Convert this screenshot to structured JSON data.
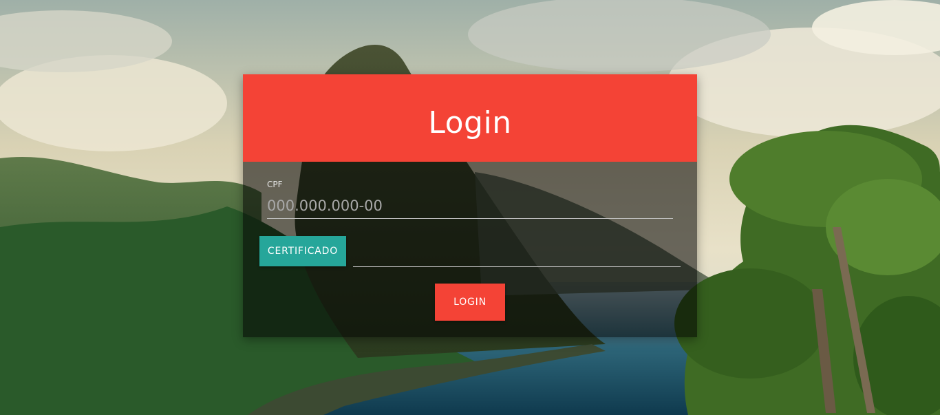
{
  "login": {
    "title": "Login",
    "cpf_label": "CPF",
    "cpf_placeholder": "000.000.000-00",
    "cpf_value": "",
    "certificate_button": "CERTIFICADO",
    "certificate_file_value": "",
    "submit_button": "LOGIN"
  },
  "colors": {
    "header": "#f44336",
    "certificate_button": "#26a69a",
    "login_button": "#f44336"
  }
}
